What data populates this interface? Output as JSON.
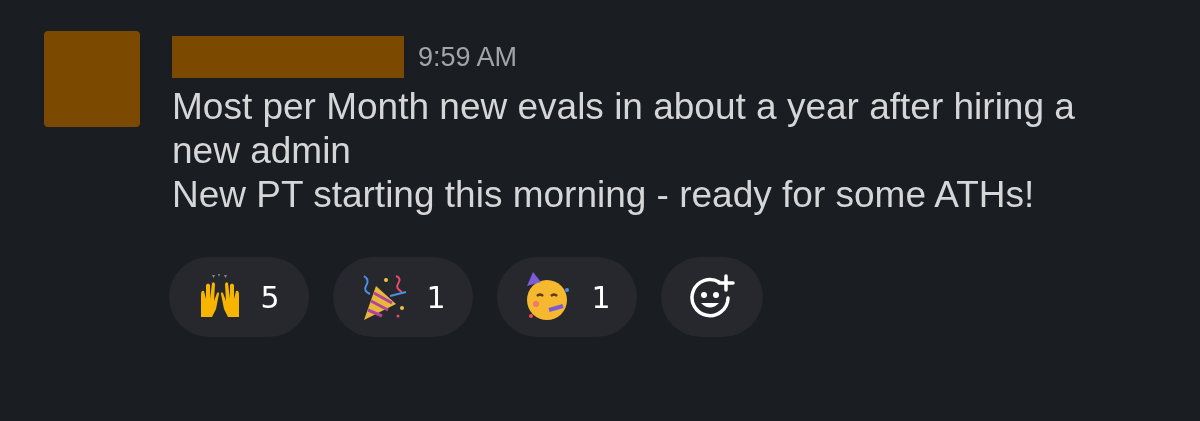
{
  "message": {
    "time": "9:59 AM",
    "paragraphs": [
      "Most per Month new evals in about a year after hiring a new admin",
      "New PT starting this morning - ready for some ATHs!"
    ]
  },
  "reactions": [
    {
      "kind": "raised-hands",
      "count": "5"
    },
    {
      "kind": "party-popper",
      "count": "1"
    },
    {
      "kind": "partying-face",
      "count": "1"
    }
  ]
}
